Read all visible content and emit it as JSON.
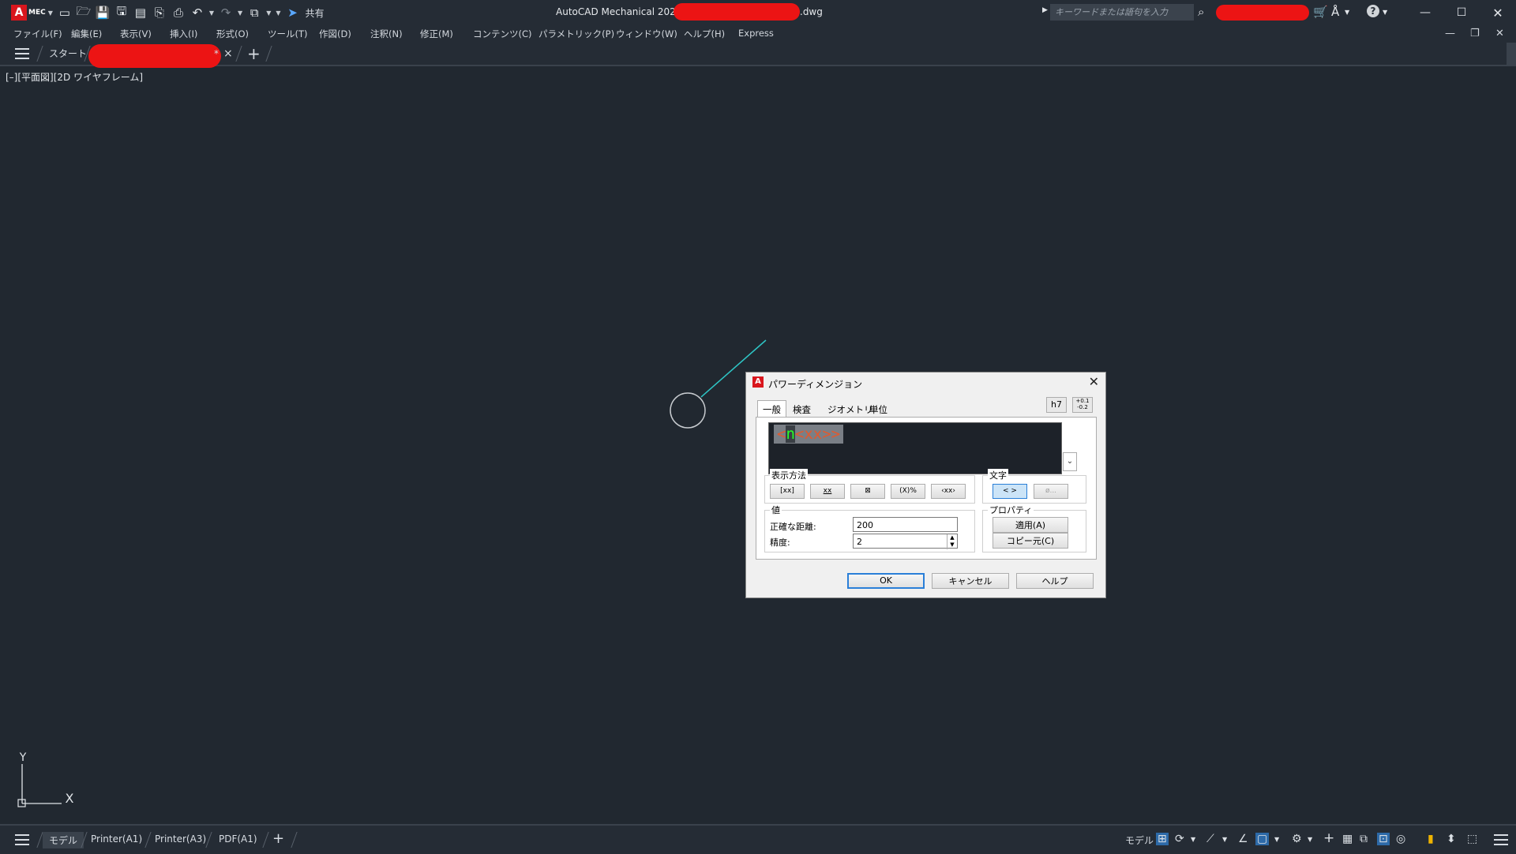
{
  "titlebar": {
    "app_logo": "A",
    "app_badge": "MEC",
    "share_label": "共有",
    "window_title": "AutoCAD Mechanical 2025",
    "filename_suffix": ".dwg",
    "search_placeholder": "キーワードまたは語句を入力",
    "icons": [
      "new-icon",
      "open-icon",
      "save-icon",
      "save-as-icon",
      "plot-preview-icon",
      "export-icon",
      "print-icon",
      "undo-icon",
      "redo-icon",
      "workspace-icon",
      "share-icon",
      "search-icon",
      "cart-icon",
      "autodesk-a-icon",
      "help-icon"
    ]
  },
  "menu": {
    "items": [
      "ファイル(F)",
      "編集(E)",
      "表示(V)",
      "挿入(I)",
      "形式(O)",
      "ツール(T)",
      "作図(D)",
      "注釈(N)",
      "修正(M)",
      "コンテンツ(C)",
      "パラメトリック(P)",
      "ウィンドウ(W)",
      "ヘルプ(H)",
      "Express"
    ]
  },
  "tabs": {
    "start_label": "スタート",
    "modified_mark": "*",
    "close_glyph": "×",
    "add_glyph": "+"
  },
  "viewport": {
    "label": "[–][平面図][2D ワイヤフレーム]",
    "ucs_x": "X",
    "ucs_y": "Y",
    "leader_color": "#2ec5c5"
  },
  "layout_tabs": {
    "items": [
      "モデル",
      "Printer(A1)",
      "Printer(A3)",
      "PDF(A1)"
    ],
    "add_glyph": "+"
  },
  "statusbar": {
    "model_label": "モデル"
  },
  "dialog": {
    "title": "パワーディメンジョン",
    "tabs": [
      "一般",
      "検査",
      "ジオメトリ",
      "単位"
    ],
    "h7_label": "h7",
    "tol_label": "+0.1\n-0.2",
    "editor_prefix": "<",
    "editor_n": "n",
    "editor_rest": "<xx>>",
    "display_group_title": "表示方法",
    "format_buttons": [
      "[xx]",
      "xx",
      "⊠",
      "(X)%",
      "‹xx›"
    ],
    "text_group_title": "文字",
    "text_buttons": [
      "< >",
      "ø..."
    ],
    "value_group_title": "値",
    "exact_distance_label": "正確な距離:",
    "exact_distance_value": "200",
    "precision_label": "精度:",
    "precision_value": "2",
    "properties_group_title": "プロパティ",
    "apply_label": "適用(A)",
    "copy_from_label": "コピー元(C)",
    "ok_label": "OK",
    "cancel_label": "キャンセル",
    "help_label": "ヘルプ"
  }
}
